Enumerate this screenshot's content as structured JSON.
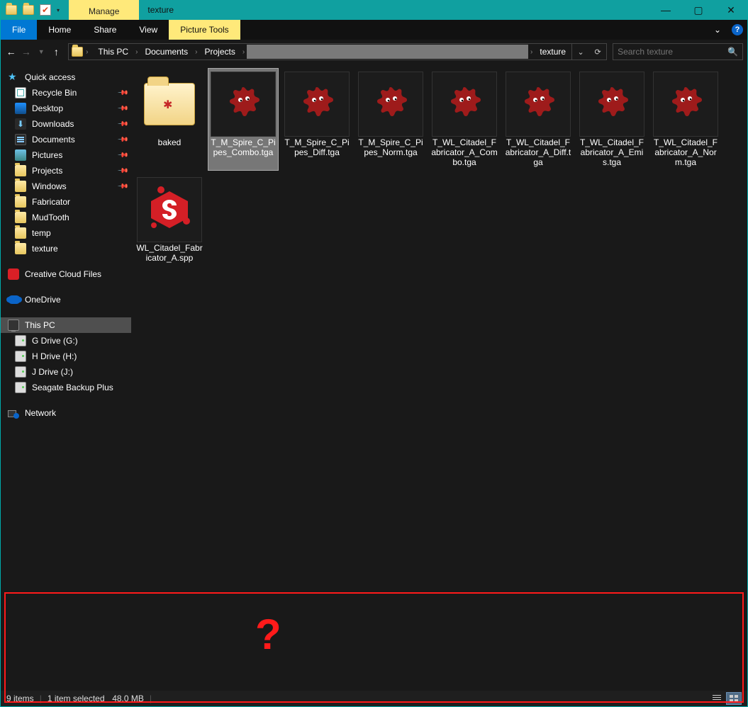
{
  "titlebar": {
    "manage": "Manage",
    "title": "texture"
  },
  "ribbon": {
    "file": "File",
    "home": "Home",
    "share": "Share",
    "view": "View",
    "picture_tools": "Picture Tools"
  },
  "address": {
    "crumbs": [
      "This PC",
      "Documents",
      "Projects",
      "",
      "texture"
    ],
    "search_placeholder": "Search texture"
  },
  "sidebar": {
    "quick_access": "Quick access",
    "qa_items": [
      {
        "icon": "bin",
        "label": "Recycle Bin",
        "pin": true
      },
      {
        "icon": "desk",
        "label": "Desktop",
        "pin": true
      },
      {
        "icon": "dl",
        "label": "Downloads",
        "pin": true
      },
      {
        "icon": "doc",
        "label": "Documents",
        "pin": true
      },
      {
        "icon": "pic",
        "label": "Pictures",
        "pin": true
      },
      {
        "icon": "folder",
        "label": "Projects",
        "pin": true
      },
      {
        "icon": "folder",
        "label": "Windows",
        "pin": true
      },
      {
        "icon": "folder",
        "label": "Fabricator",
        "pin": false
      },
      {
        "icon": "folder",
        "label": "MudTooth",
        "pin": false
      },
      {
        "icon": "folder",
        "label": "temp",
        "pin": false
      },
      {
        "icon": "folder",
        "label": "texture",
        "pin": false
      }
    ],
    "cc": "Creative Cloud Files",
    "onedrive": "OneDrive",
    "thispc": "This PC",
    "drives": [
      {
        "label": "G Drive (G:)"
      },
      {
        "label": "H Drive (H:)"
      },
      {
        "label": "J Drive (J:)"
      },
      {
        "label": "Seagate Backup Plus"
      }
    ],
    "network": "Network"
  },
  "files": [
    {
      "type": "folder",
      "name": "baked",
      "selected": false
    },
    {
      "type": "tga",
      "name": "T_M_Spire_C_Pipes_Combo.tga",
      "selected": true
    },
    {
      "type": "tga",
      "name": "T_M_Spire_C_Pipes_Diff.tga",
      "selected": false
    },
    {
      "type": "tga",
      "name": "T_M_Spire_C_Pipes_Norm.tga",
      "selected": false
    },
    {
      "type": "tga",
      "name": "T_WL_Citadel_Fabricator_A_Combo.tga",
      "selected": false
    },
    {
      "type": "tga",
      "name": "T_WL_Citadel_Fabricator_A_Diff.tga",
      "selected": false
    },
    {
      "type": "tga",
      "name": "T_WL_Citadel_Fabricator_A_Emis.tga",
      "selected": false
    },
    {
      "type": "tga",
      "name": "T_WL_Citadel_Fabricator_A_Norm.tga",
      "selected": false
    },
    {
      "type": "spp",
      "name": "WL_Citadel_Fabricator_A.spp",
      "selected": false
    }
  ],
  "status": {
    "count": "9 items",
    "selection": "1 item selected",
    "size": "48.0 MB"
  },
  "annotation": {
    "mark": "?"
  }
}
